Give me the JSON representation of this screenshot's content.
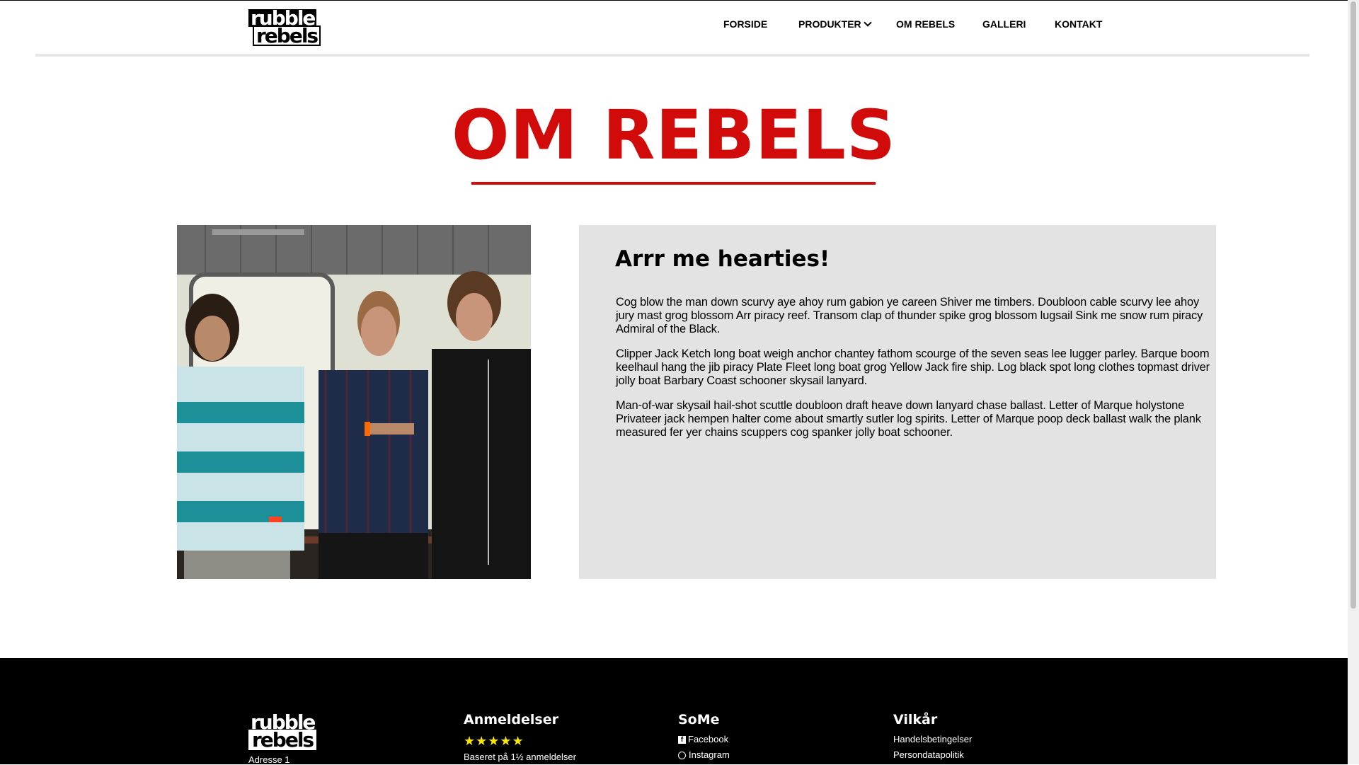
{
  "header": {
    "logo": {
      "line1": "rubble",
      "line2": "rebels"
    },
    "nav": {
      "forside": "FORSIDE",
      "produkter": "PRODUKTER",
      "om_rebels": "OM REBELS",
      "galleri": "GALLERI",
      "kontakt": "KONTAKT"
    }
  },
  "main": {
    "title": "OM REBELS",
    "heading": "Arrr me hearties!",
    "paragraphs": [
      "Cog blow the man down scurvy aye ahoy rum gabion ye careen Shiver me timbers. Doubloon cable scurvy lee ahoy jury mast grog blossom Arr piracy reef. Transom clap of thunder spike grog blossom lugsail Sink me snow rum piracy Admiral of the Black.",
      "Clipper Jack Ketch long boat weigh anchor chantey fathom scourge of the seven seas lee lugger parley. Barque boom keelhaul hang the jib piracy Plate Fleet long boat grog Yellow Jack fire ship. Log black spot long clothes topmast driver jolly boat Barbary Coast schooner skysail lanyard.",
      "Man-of-war skysail hail-shot scuttle doubloon draft heave down lanyard chase ballast. Letter of Marque holystone Privateer jack hempen halter come about smartly sutler log spirits. Letter of Marque poop deck ballast walk the plank measured fer yer chains scuppers cog spanker jolly boat schooner."
    ]
  },
  "footer": {
    "logo": {
      "line1": "rubble",
      "line2": "rebels"
    },
    "address": "Adresse 1",
    "reviews": {
      "title": "Anmeldelser",
      "stars": "★★★★★",
      "note": "Baseret på 1½ anmeldelser"
    },
    "social": {
      "title": "SoMe",
      "facebook": "Facebook",
      "instagram": "Instagram"
    },
    "terms": {
      "title": "Vilkår",
      "handels": "Handelsbetingelser",
      "persondata": "Persondatapolitik"
    }
  },
  "colors": {
    "accent": "#d10a0a",
    "panel": "#e3e3e3",
    "footer": "#000000",
    "stars": "#f6e600"
  }
}
